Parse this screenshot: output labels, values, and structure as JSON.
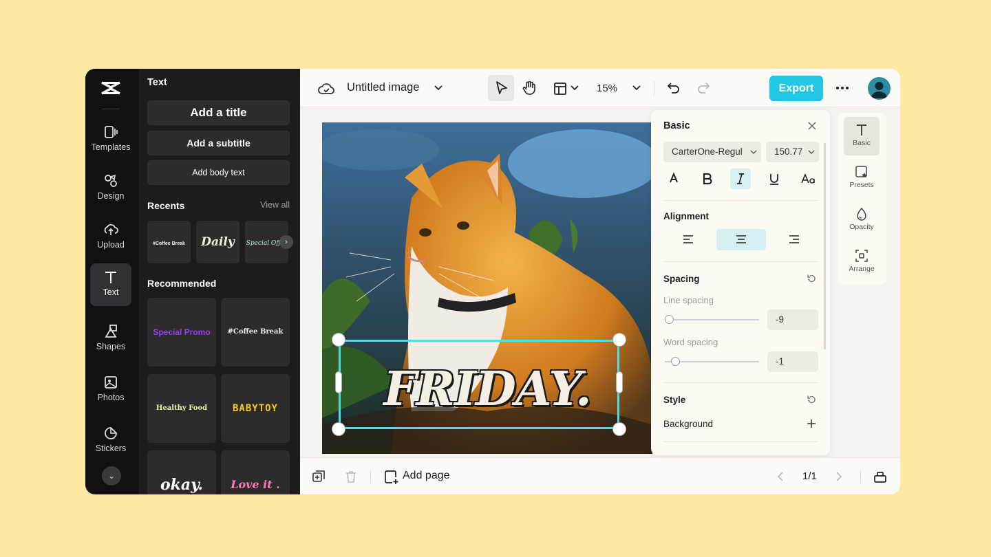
{
  "rail": {
    "items": [
      {
        "label": "Templates",
        "icon": "templates-icon"
      },
      {
        "label": "Design",
        "icon": "design-icon"
      },
      {
        "label": "Upload",
        "icon": "upload-icon"
      },
      {
        "label": "Text",
        "icon": "text-icon"
      },
      {
        "label": "Shapes",
        "icon": "shapes-icon"
      },
      {
        "label": "Photos",
        "icon": "photos-icon"
      },
      {
        "label": "Stickers",
        "icon": "stickers-icon"
      }
    ],
    "active": "Text"
  },
  "panel": {
    "title": "Text",
    "add_title": "Add a title",
    "add_subtitle": "Add a subtitle",
    "add_body": "Add body text",
    "recents_title": "Recents",
    "view_all": "View all",
    "recents": [
      "#Coffee Break",
      "Daily",
      "Special Offer"
    ],
    "recommended_title": "Recommended",
    "recommended": [
      "Special Promo",
      "#Coffee Break",
      "Healthy Food",
      "BABYTOY",
      "okay.",
      "Love it ."
    ]
  },
  "topbar": {
    "doc_title": "Untitled image",
    "zoom": "15%",
    "export_label": "Export"
  },
  "canvas": {
    "overlay_text": "FRIDAY."
  },
  "basic": {
    "title": "Basic",
    "font": "CarterOne-Regul",
    "font_size": "150.77",
    "alignment_title": "Alignment",
    "spacing_title": "Spacing",
    "line_spacing_label": "Line spacing",
    "line_spacing_value": "-9",
    "line_spacing_level": 0.0,
    "word_spacing_label": "Word spacing",
    "word_spacing_value": "-1",
    "word_spacing_level": 0.07,
    "style_title": "Style",
    "background_label": "Background"
  },
  "rtools": [
    {
      "label": "Basic",
      "icon": "text-basic-icon"
    },
    {
      "label": "Presets",
      "icon": "presets-icon"
    },
    {
      "label": "Opacity",
      "icon": "opacity-icon"
    },
    {
      "label": "Arrange",
      "icon": "arrange-icon"
    }
  ],
  "bottombar": {
    "add_page": "Add page",
    "page_indicator": "1/1"
  },
  "colors": {
    "accent": "#22c7e6",
    "selection": "#4fdcec",
    "background": "#fde9a3"
  }
}
